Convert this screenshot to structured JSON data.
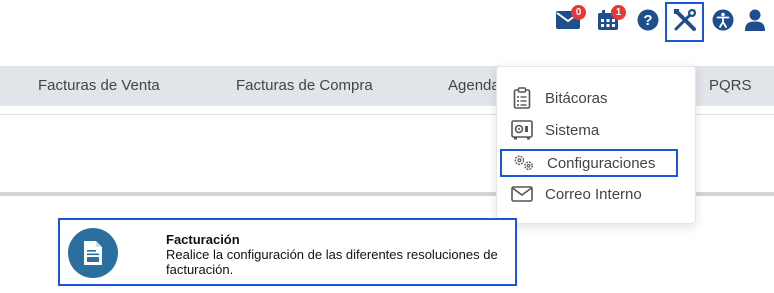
{
  "topbar": {
    "mail_icon": "envelope-icon",
    "mail_badge": "0",
    "calendar_icon": "calendar-icon",
    "calendar_badge": "1",
    "help_icon": "question-circle-icon",
    "tools_icon": "tools-icon",
    "accessibility_icon": "accessibility-icon",
    "user_icon": "user-icon",
    "accent_color": "#1f4e8c",
    "badge_color": "#e53935"
  },
  "nav": {
    "items": [
      {
        "label": "Facturas de Venta"
      },
      {
        "label": "Facturas de Compra"
      },
      {
        "label": "Agenda"
      },
      {
        "label": "PQRS"
      }
    ]
  },
  "dropdown": {
    "items": [
      {
        "label": "Bitácoras",
        "icon": "clipboard-list-icon"
      },
      {
        "label": "Sistema",
        "icon": "safe-icon"
      },
      {
        "label": "Configuraciones",
        "icon": "cogs-icon"
      },
      {
        "label": "Correo Interno",
        "icon": "envelope-outline-icon"
      }
    ],
    "selected_index": 2
  },
  "card": {
    "title": "Facturación",
    "description": "Realice la configuración de las diferentes resoluciones de facturación.",
    "icon": "invoice-document-icon",
    "icon_bg": "#2a6f9e"
  },
  "highlight_color": "#1a56db"
}
